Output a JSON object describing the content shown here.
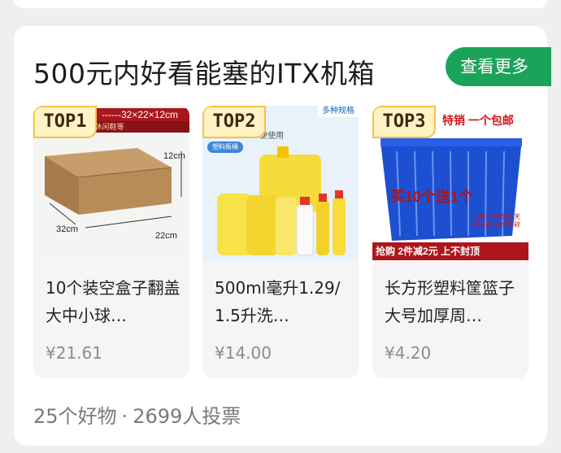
{
  "section": {
    "title": "500元内好看能塞的ITX机箱",
    "more_label": "查看更多"
  },
  "products": [
    {
      "rank": "TOP1",
      "name": "10个装空盒子翻盖大中小球…",
      "price": "¥21.61",
      "image": {
        "banner": "------32×22×12cm",
        "banner_sub": "内的普通运动鞋/休闲鞋等",
        "dim_height": "12cm",
        "dim_length": "32cm",
        "dim_width": "22cm"
      }
    },
    {
      "rank": "TOP2",
      "name": "500ml毫升1.29/1.5升洗…",
      "price": "¥14.00",
      "image": {
        "corner_tag": "多种规格",
        "subtitle": "便使用",
        "pill": "塑料瓶桶"
      }
    },
    {
      "rank": "TOP3",
      "name": "长方形塑料筐篮子大号加厚周…",
      "price": "¥4.20",
      "image": {
        "header": "特销   一个包邮",
        "promo": "买10个送1个",
        "seal": "全新料热收货 天天无毒 厨房不碎",
        "footer": "抢购 2件减2元  上不封顶"
      }
    }
  ],
  "footer": {
    "items_count": "25个好物",
    "separator": "·",
    "votes": "2699人投票"
  },
  "colors": {
    "accent": "#1ba359",
    "badge_bg": "#fff3c4",
    "badge_border": "#f3c24a"
  }
}
